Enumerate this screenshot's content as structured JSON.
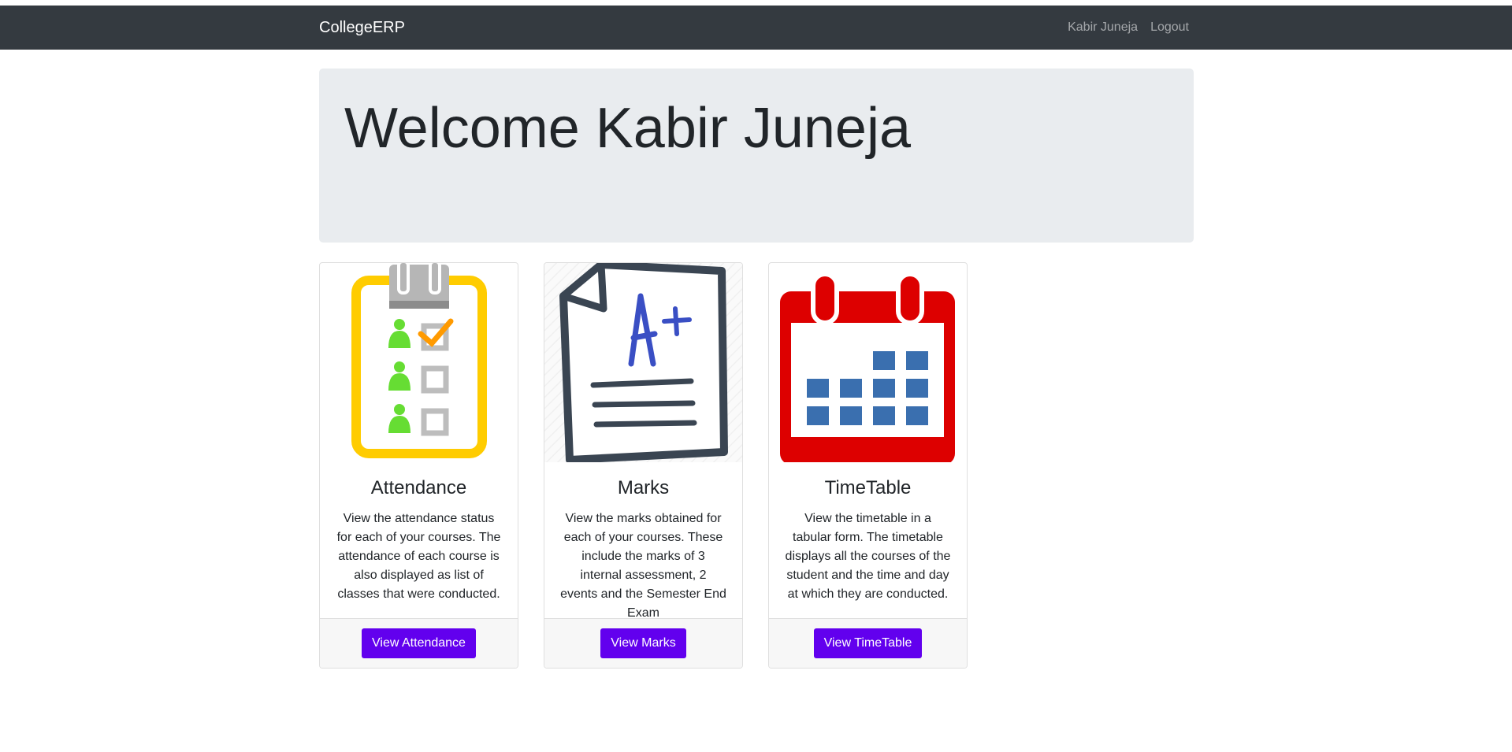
{
  "navbar": {
    "brand": "CollegeERP",
    "user_name": "Kabir Juneja",
    "logout_label": "Logout"
  },
  "jumbotron": {
    "heading": "Welcome Kabir Juneja"
  },
  "cards": [
    {
      "title": "Attendance",
      "text": "View the attendance status for each of your courses. The attendance of each course is also displayed as list of classes that were conducted.",
      "button_label": "View Attendance",
      "icon": "clipboard-checklist-icon"
    },
    {
      "title": "Marks",
      "text": "View the marks obtained for each of your courses. These include the marks of 3 internal assessment, 2 events and the Semester End Exam",
      "button_label": "View Marks",
      "icon": "graded-paper-icon"
    },
    {
      "title": "TimeTable",
      "text": "View the timetable in a tabular form. The timetable displays all the courses of the student and the time and day at which they are conducted.",
      "button_label": "View TimeTable",
      "icon": "calendar-icon"
    }
  ],
  "colors": {
    "navbar_bg": "#343a40",
    "jumbotron_bg": "#e9ecef",
    "button_bg": "#6200ee"
  }
}
